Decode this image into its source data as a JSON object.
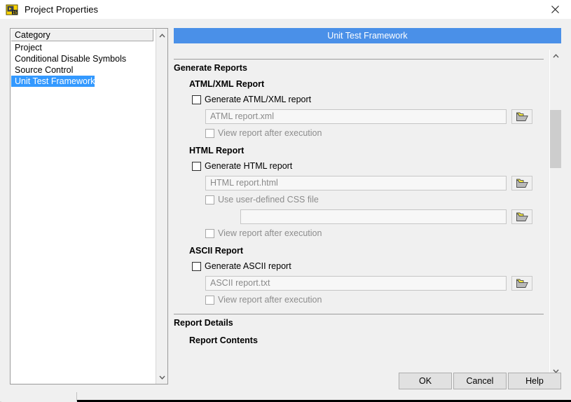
{
  "window": {
    "title": "Project Properties",
    "icon": "labview-project-icon",
    "close_icon": "close-icon"
  },
  "sidebar": {
    "header": "Category",
    "items": [
      {
        "label": "Project",
        "selected": false
      },
      {
        "label": "Conditional Disable Symbols",
        "selected": false
      },
      {
        "label": "Source Control",
        "selected": false
      },
      {
        "label": "Unit Test Framework",
        "selected": true
      }
    ],
    "scroll_up_icon": "chevron-up-icon",
    "scroll_down_icon": "chevron-down-icon"
  },
  "content": {
    "page_title": "Unit Test Framework",
    "accent_color": "#4a90e8",
    "sections": {
      "generate_reports": "Generate Reports",
      "atml_report": "ATML/XML Report",
      "html_report": "HTML Report",
      "ascii_report": "ASCII Report",
      "report_details": "Report Details",
      "report_contents": "Report Contents"
    },
    "atml": {
      "generate_label": "Generate ATML/XML report",
      "generate_checked": false,
      "path_value": "ATML report.xml",
      "path_disabled": true,
      "browse_icon": "folder-open-icon",
      "view_label": "View report after execution",
      "view_checked": false,
      "view_disabled": true
    },
    "html": {
      "generate_label": "Generate HTML report",
      "generate_checked": false,
      "path_value": "HTML report.html",
      "path_disabled": true,
      "browse_icon": "folder-open-icon",
      "css_label": "Use user-defined CSS file",
      "css_checked": false,
      "css_disabled": true,
      "css_path_value": "",
      "css_browse_icon": "folder-open-icon",
      "view_label": "View report after execution",
      "view_checked": false,
      "view_disabled": true
    },
    "ascii": {
      "generate_label": "Generate ASCII report",
      "generate_checked": false,
      "path_value": "ASCII report.txt",
      "path_disabled": true,
      "browse_icon": "folder-open-icon",
      "view_label": "View report after execution",
      "view_checked": false,
      "view_disabled": true
    },
    "scroll_up_icon": "chevron-up-icon",
    "scroll_down_icon": "chevron-down-icon"
  },
  "buttons": {
    "ok": "OK",
    "cancel": "Cancel",
    "help": "Help"
  }
}
